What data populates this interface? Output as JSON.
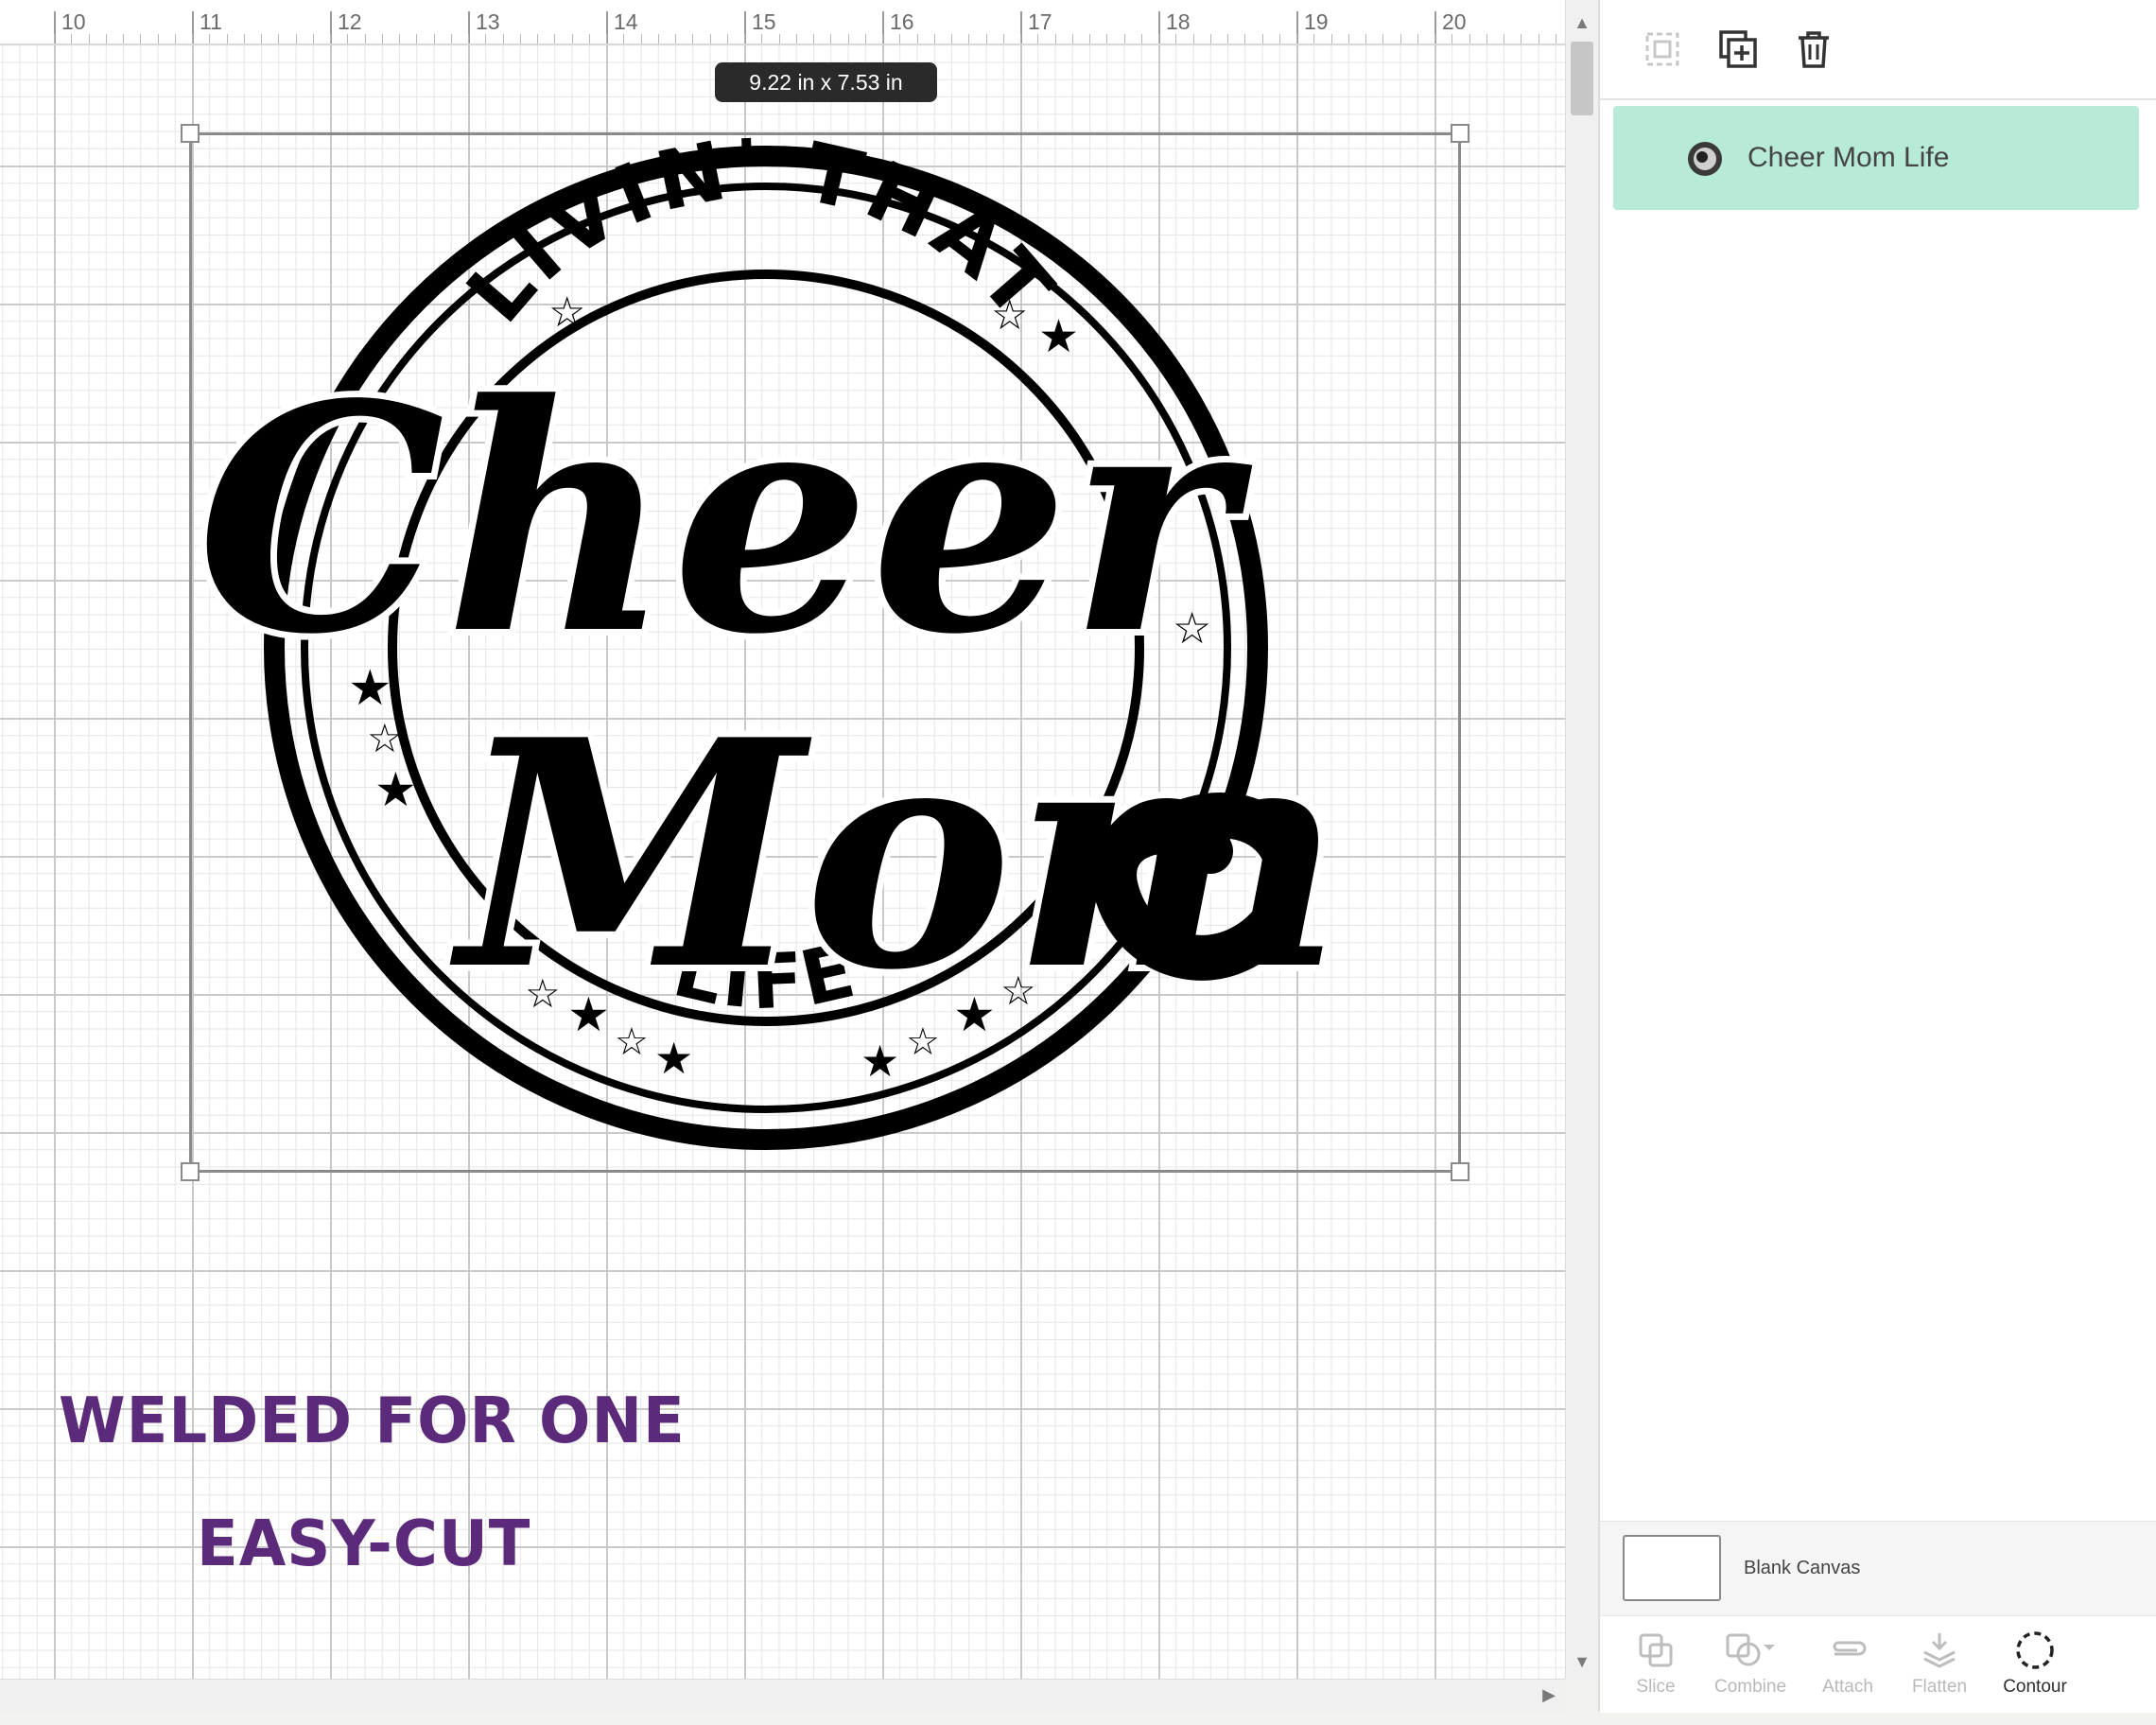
{
  "ruler": {
    "labels": [
      "10",
      "11",
      "12",
      "13",
      "14",
      "15",
      "16",
      "17",
      "18",
      "19",
      "20"
    ]
  },
  "canvas": {
    "dimension_label": "9.22  in x 7.53  in",
    "design": {
      "top_arc_text": "LIVIN' THAT",
      "word_1": "Cheer",
      "word_2": "Mom",
      "bottom_text": "LIFE"
    },
    "notes": {
      "line_1": "WELDED FOR ONE",
      "line_2": "EASY-CUT"
    }
  },
  "layers_panel": {
    "toolbar": {
      "group_icon": "group-icon",
      "duplicate_icon": "duplicate-icon",
      "delete_icon": "trash-icon"
    },
    "layers": [
      {
        "label": "Cheer Mom Life",
        "selected": true
      }
    ],
    "blank_canvas": {
      "label": "Blank Canvas"
    },
    "tools": [
      {
        "label": "Slice",
        "enabled": false,
        "icon": "slice-icon"
      },
      {
        "label": "Combine",
        "enabled": false,
        "icon": "combine-icon"
      },
      {
        "label": "Attach",
        "enabled": false,
        "icon": "attach-icon"
      },
      {
        "label": "Flatten",
        "enabled": false,
        "icon": "flatten-icon"
      },
      {
        "label": "Contour",
        "enabled": true,
        "icon": "contour-icon"
      }
    ]
  },
  "colors": {
    "layer_highlight": "#b8ead8",
    "note_text": "#5b2a7a",
    "design_fill": "#000000"
  }
}
